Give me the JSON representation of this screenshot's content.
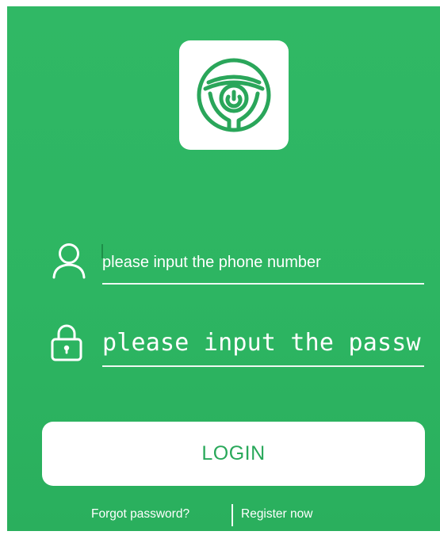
{
  "app": {
    "background_color": "#2db562",
    "accent_color": "#29a85a"
  },
  "logo": {
    "icon": "power-wheel-icon"
  },
  "phone_field": {
    "icon": "user-icon",
    "placeholder": "please input the phone number",
    "value": ""
  },
  "password_field": {
    "icon": "lock-icon",
    "placeholder": "please input the passw",
    "value": ""
  },
  "login_button": {
    "label": "LOGIN"
  },
  "links": {
    "forgot_password": "Forgot password?",
    "register_now": "Register now"
  }
}
